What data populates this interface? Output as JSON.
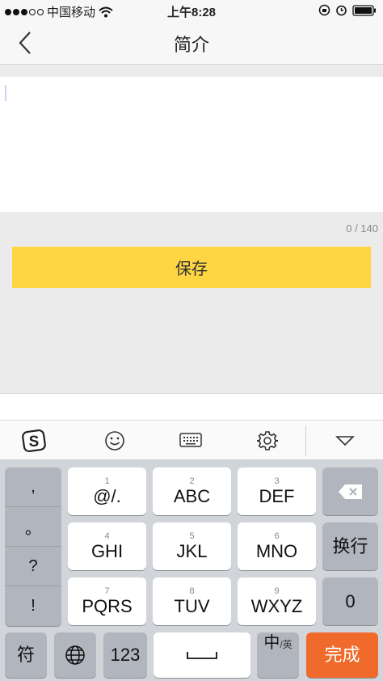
{
  "status_bar": {
    "carrier": "中国移动",
    "time": "上午8:28"
  },
  "nav": {
    "title": "简介"
  },
  "editor": {
    "counter": "0 / 140"
  },
  "save_button": "保存",
  "toolbar": {
    "icons": [
      "sogou-logo-icon",
      "emoji-icon",
      "keyboard-icon",
      "settings-gear-icon",
      "collapse-keyboard-icon"
    ]
  },
  "keyboard": {
    "punctuation": [
      ",",
      "。",
      "?",
      "!"
    ],
    "keys": [
      {
        "num": "1",
        "label": "@/."
      },
      {
        "num": "2",
        "label": "ABC"
      },
      {
        "num": "3",
        "label": "DEF"
      },
      {
        "num": "4",
        "label": "GHI"
      },
      {
        "num": "5",
        "label": "JKL"
      },
      {
        "num": "6",
        "label": "MNO"
      },
      {
        "num": "7",
        "label": "PQRS"
      },
      {
        "num": "8",
        "label": "TUV"
      },
      {
        "num": "9",
        "label": "WXYZ"
      }
    ],
    "newline": "换行",
    "zero": "0",
    "symbol": "符",
    "numbers": "123",
    "lang_main": "中",
    "lang_sub": "/英",
    "done": "完成",
    "accent_color": "#f06b2b"
  }
}
